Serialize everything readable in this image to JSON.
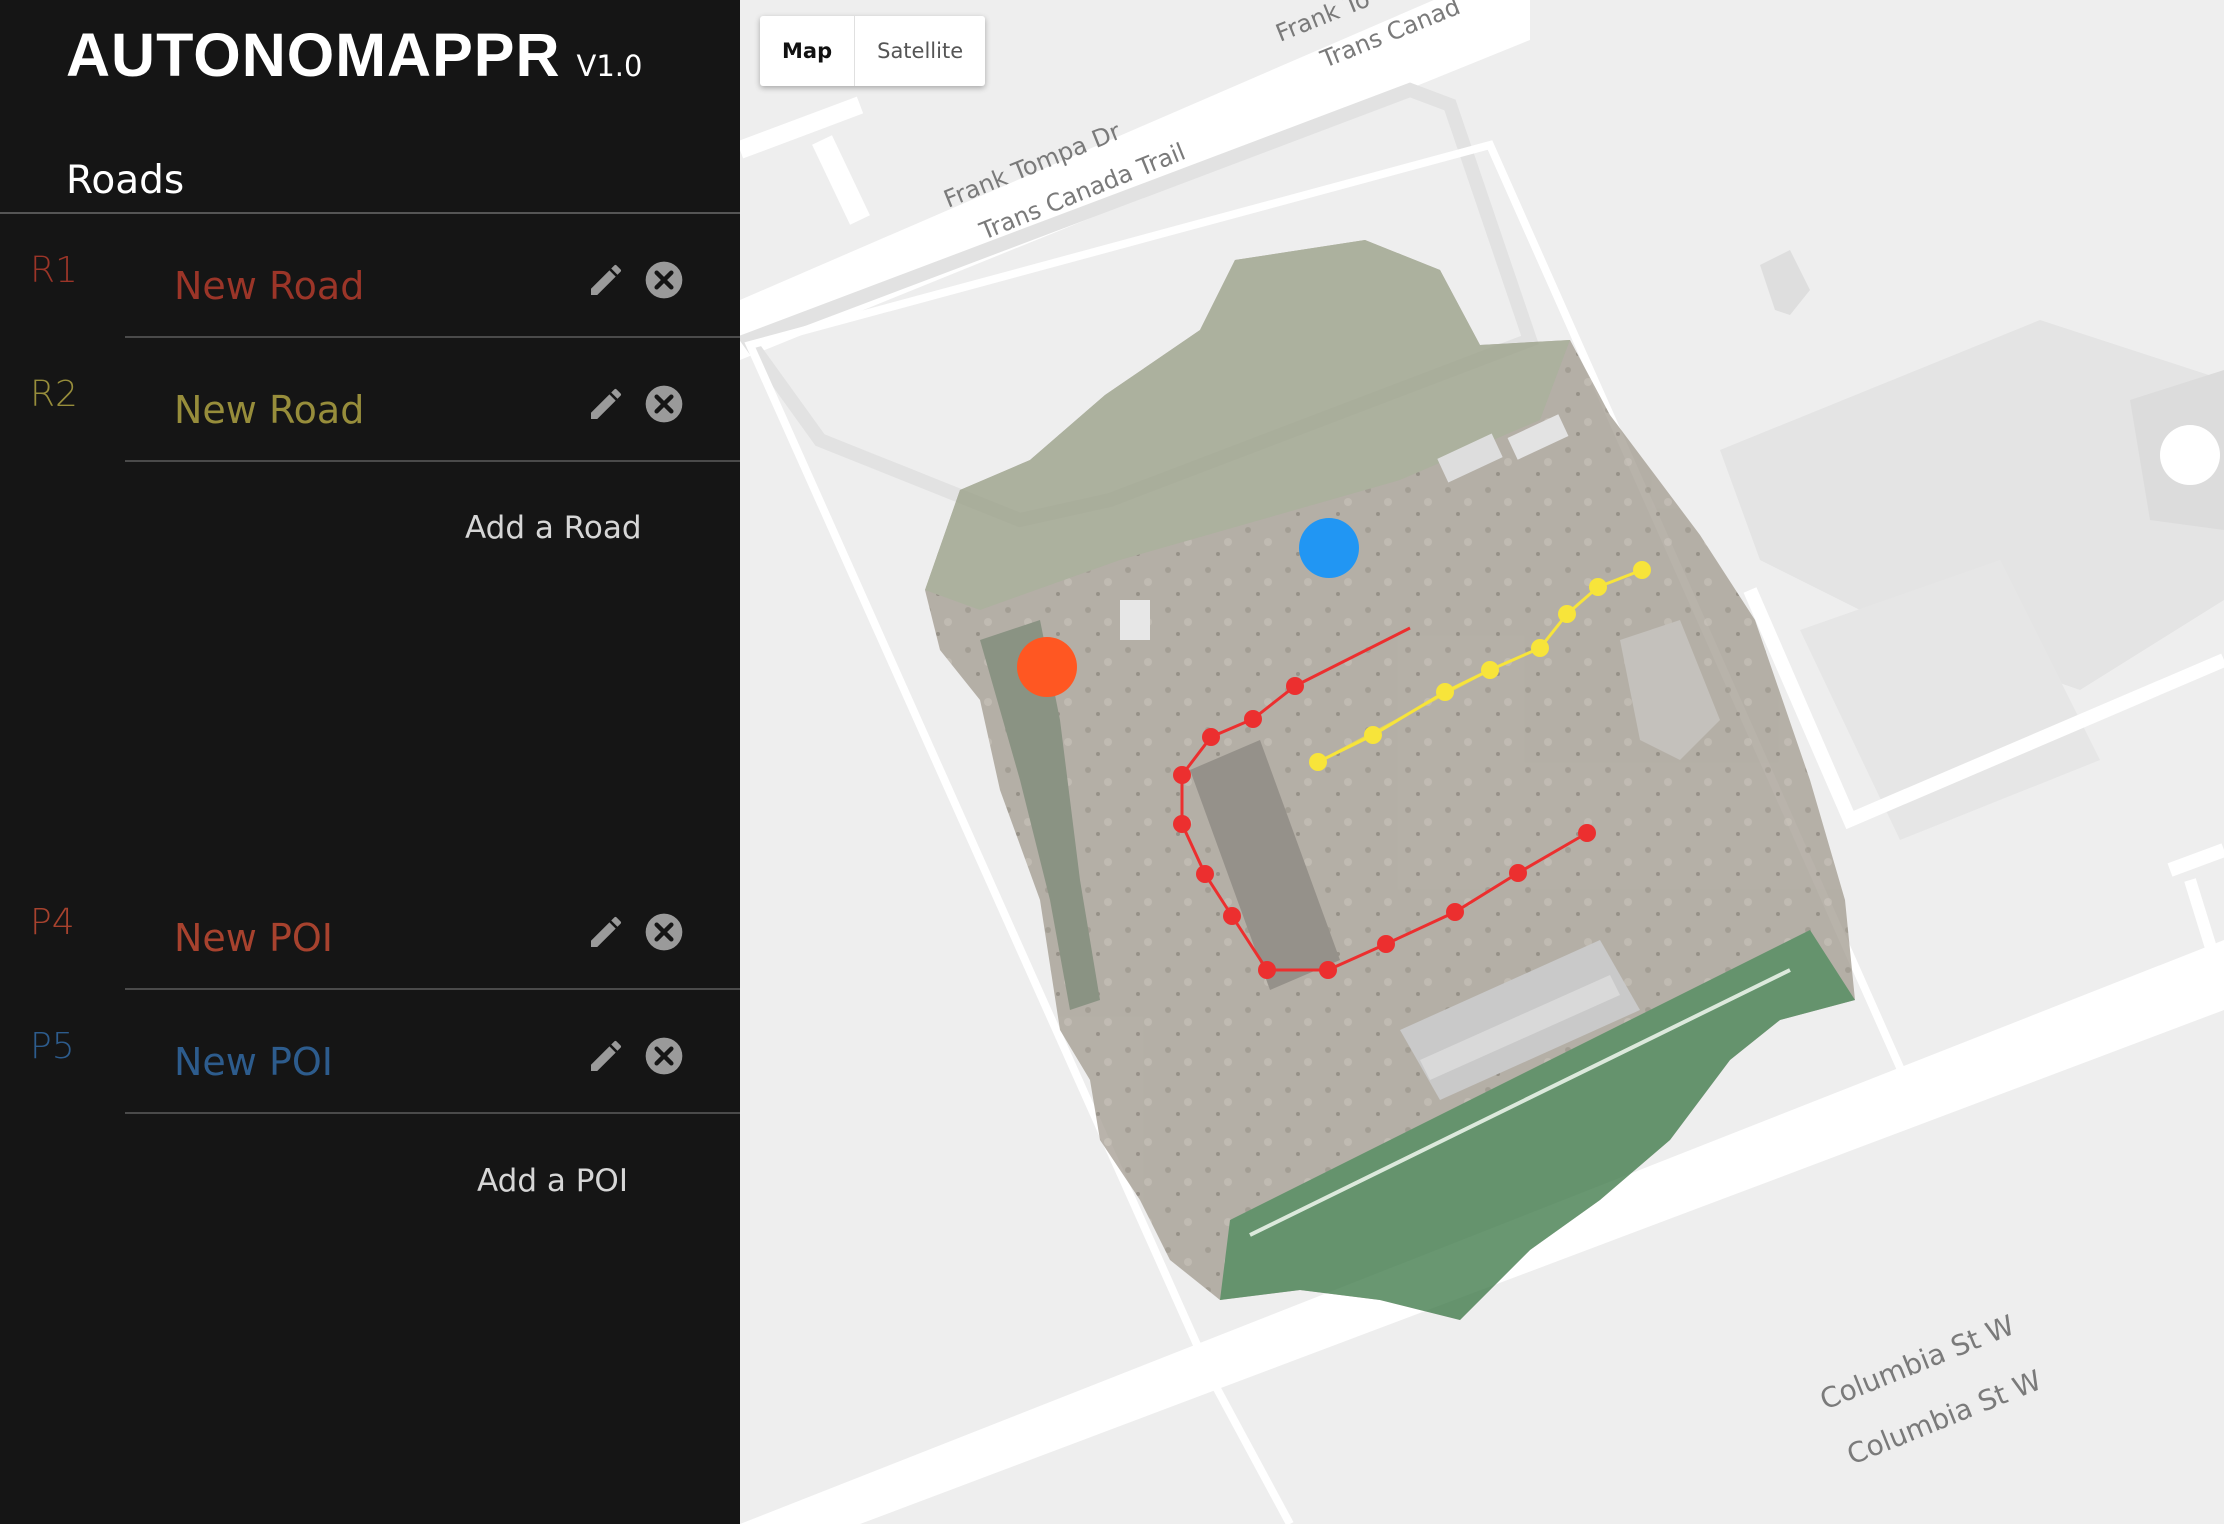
{
  "app": {
    "title": "AUTONOMAPPR",
    "version": "V1.0"
  },
  "sidebar": {
    "section_title": "Roads",
    "roads": [
      {
        "code": "R1",
        "name": "New Road",
        "color": "#9b3528"
      },
      {
        "code": "R2",
        "name": "New Road",
        "color": "#978d3b"
      }
    ],
    "add_road_label": "Add a Road",
    "pois": [
      {
        "code": "P4",
        "name": "New POI",
        "color": "#a7422e"
      },
      {
        "code": "P5",
        "name": "New POI",
        "color": "#2d5c8d"
      }
    ],
    "add_poi_label": "Add a POI",
    "icons": {
      "edit": "pencil-icon",
      "delete": "close-circle-icon"
    }
  },
  "map": {
    "toggle": {
      "map_label": "Map",
      "satellite_label": "Satellite",
      "selected": "Map"
    },
    "street_labels": [
      "Frank Tompa Dr",
      "Trans Canada Trail",
      "Frank To",
      "Trans Canad",
      "Columbia St W",
      "Columbia St W"
    ],
    "colors": {
      "road1": "#ec2f2f",
      "road2": "#f7e43a",
      "poi_orange": "#ff5722",
      "poi_blue": "#2196f3"
    }
  }
}
